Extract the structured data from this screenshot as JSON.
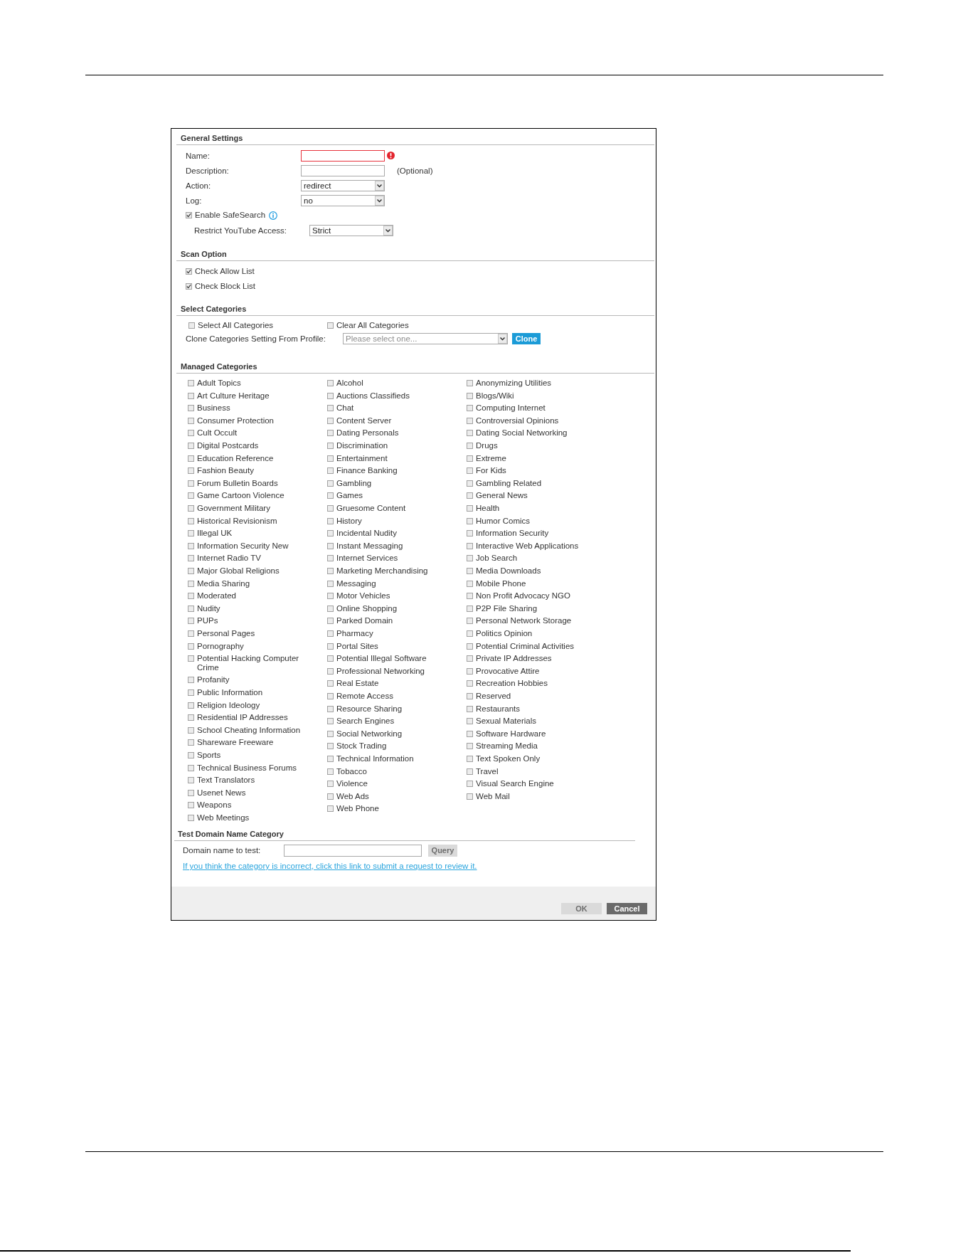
{
  "general_settings": {
    "heading": "General Settings",
    "rows": [
      {
        "kind": "text",
        "label": "Name:",
        "invalid": true
      },
      {
        "kind": "text",
        "label": "Description:",
        "invalid": false,
        "note": "(Optional)"
      },
      {
        "kind": "select",
        "label": "Action:",
        "value": "redirect"
      },
      {
        "kind": "select",
        "label": "Log:",
        "value": "no"
      },
      {
        "kind": "checkbox",
        "label": "Enable SafeSearch",
        "checked": true,
        "info_icon": true,
        "children": [
          {
            "kind": "select",
            "label": "Restrict YouTube Access:",
            "value": "Strict"
          }
        ]
      }
    ]
  },
  "scan_option": {
    "heading": "Scan Option",
    "options": [
      {
        "label": "Check Allow List",
        "checked": true
      },
      {
        "label": "Check Block List",
        "checked": true
      }
    ]
  },
  "select_categories": {
    "heading": "Select Categories",
    "toggles": [
      {
        "label": "Select All Categories",
        "checked": false
      },
      {
        "label": "Clear All Categories",
        "checked": false
      }
    ],
    "clone": {
      "label": "Clone Categories Setting From Profile:",
      "placeholder": "Please select one...",
      "button": "Clone"
    }
  },
  "managed_categories": {
    "heading": "Managed Categories",
    "columns": [
      [
        {
          "label": "Adult Topics",
          "checked": false
        },
        {
          "label": "Art Culture Heritage",
          "checked": false
        },
        {
          "label": "Business",
          "checked": false
        },
        {
          "label": "Consumer Protection",
          "checked": false
        },
        {
          "label": "Cult Occult",
          "checked": false
        },
        {
          "label": "Digital Postcards",
          "checked": false
        },
        {
          "label": "Education Reference",
          "checked": false
        },
        {
          "label": "Fashion Beauty",
          "checked": false
        },
        {
          "label": "Forum Bulletin Boards",
          "checked": false
        },
        {
          "label": "Game Cartoon Violence",
          "checked": false
        },
        {
          "label": "Government Military",
          "checked": false
        },
        {
          "label": "Historical Revisionism",
          "checked": false
        },
        {
          "label": "Illegal UK",
          "checked": false
        },
        {
          "label": "Information Security New",
          "checked": false
        },
        {
          "label": "Internet Radio TV",
          "checked": false
        },
        {
          "label": "Major Global Religions",
          "checked": false
        },
        {
          "label": "Media Sharing",
          "checked": false
        },
        {
          "label": "Moderated",
          "checked": false
        },
        {
          "label": "Nudity",
          "checked": false
        },
        {
          "label": "PUPs",
          "checked": false
        },
        {
          "label": "Personal Pages",
          "checked": false
        },
        {
          "label": "Pornography",
          "checked": false
        },
        {
          "label": "Potential Hacking Computer Crime",
          "checked": false
        },
        {
          "label": "Profanity",
          "checked": false
        },
        {
          "label": "Public Information",
          "checked": false
        },
        {
          "label": "Religion Ideology",
          "checked": false
        },
        {
          "label": "Residential IP Addresses",
          "checked": false
        },
        {
          "label": "School Cheating Information",
          "checked": false
        },
        {
          "label": "Shareware Freeware",
          "checked": false
        },
        {
          "label": "Sports",
          "checked": false
        },
        {
          "label": "Technical Business Forums",
          "checked": false
        },
        {
          "label": "Text Translators",
          "checked": false
        },
        {
          "label": "Usenet News",
          "checked": false
        },
        {
          "label": "Weapons",
          "checked": false
        },
        {
          "label": "Web Meetings",
          "checked": false
        }
      ],
      [
        {
          "label": "Alcohol",
          "checked": false
        },
        {
          "label": "Auctions Classifieds",
          "checked": false
        },
        {
          "label": "Chat",
          "checked": false
        },
        {
          "label": "Content Server",
          "checked": false
        },
        {
          "label": "Dating Personals",
          "checked": false
        },
        {
          "label": "Discrimination",
          "checked": false
        },
        {
          "label": "Entertainment",
          "checked": false
        },
        {
          "label": "Finance Banking",
          "checked": false
        },
        {
          "label": "Gambling",
          "checked": false
        },
        {
          "label": "Games",
          "checked": false
        },
        {
          "label": "Gruesome Content",
          "checked": false
        },
        {
          "label": "History",
          "checked": false
        },
        {
          "label": "Incidental Nudity",
          "checked": false
        },
        {
          "label": "Instant Messaging",
          "checked": false
        },
        {
          "label": "Internet Services",
          "checked": false
        },
        {
          "label": "Marketing Merchandising",
          "checked": false
        },
        {
          "label": "Messaging",
          "checked": false
        },
        {
          "label": "Motor Vehicles",
          "checked": false
        },
        {
          "label": "Online Shopping",
          "checked": false
        },
        {
          "label": "Parked Domain",
          "checked": false
        },
        {
          "label": "Pharmacy",
          "checked": false
        },
        {
          "label": "Portal Sites",
          "checked": false
        },
        {
          "label": "Potential Illegal Software",
          "checked": false
        },
        {
          "label": "Professional Networking",
          "checked": false
        },
        {
          "label": "Real Estate",
          "checked": false
        },
        {
          "label": "Remote Access",
          "checked": false
        },
        {
          "label": "Resource Sharing",
          "checked": false
        },
        {
          "label": "Search Engines",
          "checked": false
        },
        {
          "label": "Social Networking",
          "checked": false
        },
        {
          "label": "Stock Trading",
          "checked": false
        },
        {
          "label": "Technical Information",
          "checked": false
        },
        {
          "label": "Tobacco",
          "checked": false
        },
        {
          "label": "Violence",
          "checked": false
        },
        {
          "label": "Web Ads",
          "checked": false
        },
        {
          "label": "Web Phone",
          "checked": false
        }
      ],
      [
        {
          "label": "Anonymizing Utilities",
          "checked": false
        },
        {
          "label": "Blogs/Wiki",
          "checked": false
        },
        {
          "label": "Computing Internet",
          "checked": false
        },
        {
          "label": "Controversial Opinions",
          "checked": false
        },
        {
          "label": "Dating Social Networking",
          "checked": false
        },
        {
          "label": "Drugs",
          "checked": false
        },
        {
          "label": "Extreme",
          "checked": false
        },
        {
          "label": "For Kids",
          "checked": false
        },
        {
          "label": "Gambling Related",
          "checked": false
        },
        {
          "label": "General News",
          "checked": false
        },
        {
          "label": "Health",
          "checked": false
        },
        {
          "label": "Humor Comics",
          "checked": false
        },
        {
          "label": "Information Security",
          "checked": false
        },
        {
          "label": "Interactive Web Applications",
          "checked": false
        },
        {
          "label": "Job Search",
          "checked": false
        },
        {
          "label": "Media Downloads",
          "checked": false
        },
        {
          "label": "Mobile Phone",
          "checked": false
        },
        {
          "label": "Non Profit Advocacy NGO",
          "checked": false
        },
        {
          "label": "P2P File Sharing",
          "checked": false
        },
        {
          "label": "Personal Network Storage",
          "checked": false
        },
        {
          "label": "Politics Opinion",
          "checked": false
        },
        {
          "label": "Potential Criminal Activities",
          "checked": false
        },
        {
          "label": "Private IP Addresses",
          "checked": false
        },
        {
          "label": "Provocative Attire",
          "checked": false
        },
        {
          "label": "Recreation Hobbies",
          "checked": false
        },
        {
          "label": "Reserved",
          "checked": false
        },
        {
          "label": "Restaurants",
          "checked": false
        },
        {
          "label": "Sexual Materials",
          "checked": false
        },
        {
          "label": "Software Hardware",
          "checked": false
        },
        {
          "label": "Streaming Media",
          "checked": false
        },
        {
          "label": "Text Spoken Only",
          "checked": false
        },
        {
          "label": "Travel",
          "checked": false
        },
        {
          "label": "Visual Search Engine",
          "checked": false
        },
        {
          "label": "Web Mail",
          "checked": false
        }
      ]
    ]
  },
  "test_domain": {
    "heading": "Test Domain Name Category",
    "label": "Domain name to test:",
    "button": {
      "label": "Query",
      "disabled": true
    },
    "link": "If you think the category is incorrect, click this link to submit a request to review it."
  },
  "buttons": [
    {
      "label": "OK",
      "disabled": true
    },
    {
      "label": "Cancel",
      "disabled": false
    }
  ]
}
